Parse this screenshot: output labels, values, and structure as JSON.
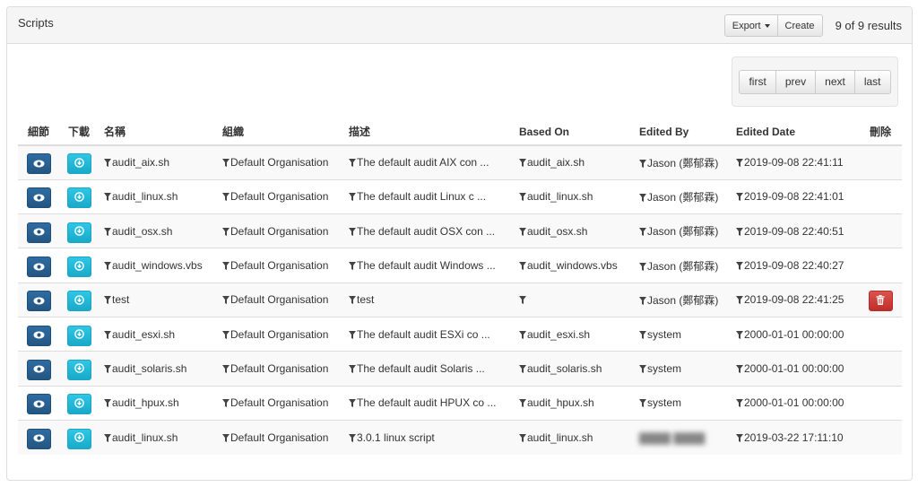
{
  "header": {
    "title": "Scripts",
    "export_label": "Export",
    "create_label": "Create",
    "results_text": "9 of 9 results"
  },
  "pager": {
    "first": "first",
    "prev": "prev",
    "next": "next",
    "last": "last"
  },
  "columns": [
    "細節",
    "下載",
    "名稱",
    "組織",
    "描述",
    "Based On",
    "Edited By",
    "Edited Date",
    "刪除"
  ],
  "colors": {
    "view": "#2d6ca2",
    "download": "#2fc7e6",
    "delete": "#d9534f"
  },
  "rows": [
    {
      "name": "audit_aix.sh",
      "org": "Default Organisation",
      "desc": "The default audit AIX con ...",
      "based_on": "audit_aix.sh",
      "edited_by": "Jason (鄭郁霖)",
      "edited_date": "2019-09-08 22:41:11",
      "deletable": false
    },
    {
      "name": "audit_linux.sh",
      "org": "Default Organisation",
      "desc": "The default audit Linux c ...",
      "based_on": "audit_linux.sh",
      "edited_by": "Jason (鄭郁霖)",
      "edited_date": "2019-09-08 22:41:01",
      "deletable": false
    },
    {
      "name": "audit_osx.sh",
      "org": "Default Organisation",
      "desc": "The default audit OSX con ...",
      "based_on": "audit_osx.sh",
      "edited_by": "Jason (鄭郁霖)",
      "edited_date": "2019-09-08 22:40:51",
      "deletable": false
    },
    {
      "name": "audit_windows.vbs",
      "org": "Default Organisation",
      "desc": "The default audit Windows ...",
      "based_on": "audit_windows.vbs",
      "edited_by": "Jason (鄭郁霖)",
      "edited_date": "2019-09-08 22:40:27",
      "deletable": false
    },
    {
      "name": "test",
      "org": "Default Organisation",
      "desc": "test",
      "based_on": "",
      "edited_by": "Jason (鄭郁霖)",
      "edited_date": "2019-09-08 22:41:25",
      "deletable": true
    },
    {
      "name": "audit_esxi.sh",
      "org": "Default Organisation",
      "desc": "The default audit ESXi co ...",
      "based_on": "audit_esxi.sh",
      "edited_by": "system",
      "edited_date": "2000-01-01 00:00:00",
      "deletable": false
    },
    {
      "name": "audit_solaris.sh",
      "org": "Default Organisation",
      "desc": "The default audit Solaris ...",
      "based_on": "audit_solaris.sh",
      "edited_by": "system",
      "edited_date": "2000-01-01 00:00:00",
      "deletable": false
    },
    {
      "name": "audit_hpux.sh",
      "org": "Default Organisation",
      "desc": "The default audit HPUX co ...",
      "based_on": "audit_hpux.sh",
      "edited_by": "system",
      "edited_date": "2000-01-01 00:00:00",
      "deletable": false
    },
    {
      "name": "audit_linux.sh",
      "org": "Default Organisation",
      "desc": "3.0.1 linux script",
      "based_on": "audit_linux.sh",
      "edited_by": "",
      "edited_by_blurred": true,
      "edited_date": "2019-03-22 17:11:10",
      "deletable": false
    }
  ]
}
